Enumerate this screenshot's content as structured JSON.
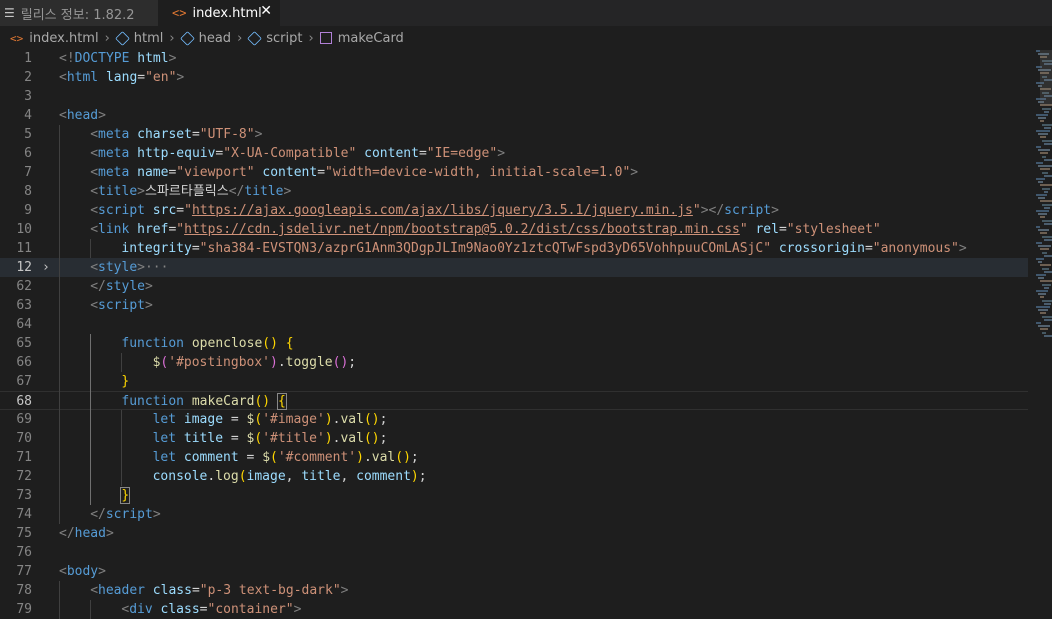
{
  "tabs": [
    {
      "label": "릴리스 정보: 1.82.2",
      "icon": "markdown-preview-icon",
      "active": false
    },
    {
      "label": "index.html",
      "icon": "html-file-icon",
      "active": true,
      "close": "✕"
    }
  ],
  "breadcrumb": [
    "index.html",
    "html",
    "head",
    "script",
    "makeCard"
  ],
  "cursor_line": "68",
  "lines": [
    {
      "n": "1"
    },
    {
      "n": "2"
    },
    {
      "n": "3"
    },
    {
      "n": "4"
    },
    {
      "n": "5"
    },
    {
      "n": "6"
    },
    {
      "n": "7"
    },
    {
      "n": "8"
    },
    {
      "n": "9"
    },
    {
      "n": "10"
    },
    {
      "n": "11"
    },
    {
      "n": "12"
    },
    {
      "n": "62"
    },
    {
      "n": "63"
    },
    {
      "n": "64"
    },
    {
      "n": "65"
    },
    {
      "n": "66"
    },
    {
      "n": "67"
    },
    {
      "n": "68"
    },
    {
      "n": "69"
    },
    {
      "n": "70"
    },
    {
      "n": "71"
    },
    {
      "n": "72"
    },
    {
      "n": "73"
    },
    {
      "n": "74"
    },
    {
      "n": "75"
    },
    {
      "n": "76"
    },
    {
      "n": "77"
    },
    {
      "n": "78"
    },
    {
      "n": "79"
    }
  ],
  "code": {
    "l1": [
      "<!",
      "DOCTYPE",
      " html",
      ">"
    ],
    "l2": [
      "<",
      "html",
      " lang",
      "=",
      "\"en\"",
      ">"
    ],
    "l4": [
      "<",
      "head",
      ">"
    ],
    "l5": [
      "<",
      "meta",
      " charset",
      "=",
      "\"UTF-8\"",
      ">"
    ],
    "l6": [
      "<",
      "meta",
      " http-equiv",
      "=",
      "\"X-UA-Compatible\"",
      " content",
      "=",
      "\"IE=edge\"",
      ">"
    ],
    "l7": [
      "<",
      "meta",
      " name",
      "=",
      "\"viewport\"",
      " content",
      "=",
      "\"width=device-width, initial-scale=1.0\"",
      ">"
    ],
    "l8": [
      "<",
      "title",
      ">",
      "스파르타플릭스",
      "</",
      "title",
      ">"
    ],
    "l9": [
      "<",
      "script",
      " src",
      "=",
      "\"",
      "https://ajax.googleapis.com/ajax/libs/jquery/3.5.1/jquery.min.js",
      "\"",
      "></",
      "script",
      ">"
    ],
    "l10": [
      "<",
      "link",
      " href",
      "=",
      "\"",
      "https://cdn.jsdelivr.net/npm/bootstrap@5.0.2/dist/css/bootstrap.min.css",
      "\"",
      " rel",
      "=",
      "\"stylesheet\""
    ],
    "l11": [
      "integrity",
      "=",
      "\"sha384-EVSTQN3/azprG1Anm3QDgpJLIm9Nao0Yz1ztcQTwFspd3yD65VohhpuuCOmLASjC\"",
      " crossorigin",
      "=",
      "\"anonymous\"",
      ">"
    ],
    "l12": [
      "<",
      "style",
      ">",
      "···"
    ],
    "l62": [
      "</",
      "style",
      ">"
    ],
    "l63": [
      "<",
      "script",
      ">"
    ],
    "l65": [
      "function",
      " ",
      "openclose",
      "(",
      ")",
      " ",
      "{"
    ],
    "l66": [
      "$",
      "(",
      "'#postingbox'",
      ")",
      ".",
      "toggle",
      "(",
      ")",
      ";"
    ],
    "l67": [
      "}"
    ],
    "l68": [
      "function",
      " ",
      "makeCard",
      "(",
      ")",
      " ",
      "{"
    ],
    "l69": [
      "let",
      " ",
      "image",
      " = ",
      "$",
      "(",
      "'#image'",
      ")",
      ".",
      "val",
      "(",
      ")",
      ";"
    ],
    "l70": [
      "let",
      " ",
      "title",
      " = ",
      "$",
      "(",
      "'#title'",
      ")",
      ".",
      "val",
      "(",
      ")",
      ";"
    ],
    "l71": [
      "let",
      " ",
      "comment",
      " = ",
      "$",
      "(",
      "'#comment'",
      ")",
      ".",
      "val",
      "(",
      ")",
      ";"
    ],
    "l72": [
      "console",
      ".",
      "log",
      "(",
      "image",
      ", ",
      "title",
      ", ",
      "comment",
      ")",
      ";"
    ],
    "l73": [
      "}"
    ],
    "l74": [
      "</",
      "script",
      ">"
    ],
    "l75": [
      "</",
      "head",
      ">"
    ],
    "l77": [
      "<",
      "body",
      ">"
    ],
    "l78": [
      "<",
      "header",
      " class",
      "=",
      "\"p-3 text-bg-dark\"",
      ">"
    ],
    "l79": [
      "<",
      "div",
      " class",
      "=",
      "\"container\"",
      ">"
    ]
  },
  "colors": {
    "background": "#1e1e1e",
    "tag": "#569cd6",
    "attr": "#9cdcfe",
    "string": "#ce9178",
    "function": "#dcdcaa",
    "bracket_gold": "#ffd700"
  }
}
